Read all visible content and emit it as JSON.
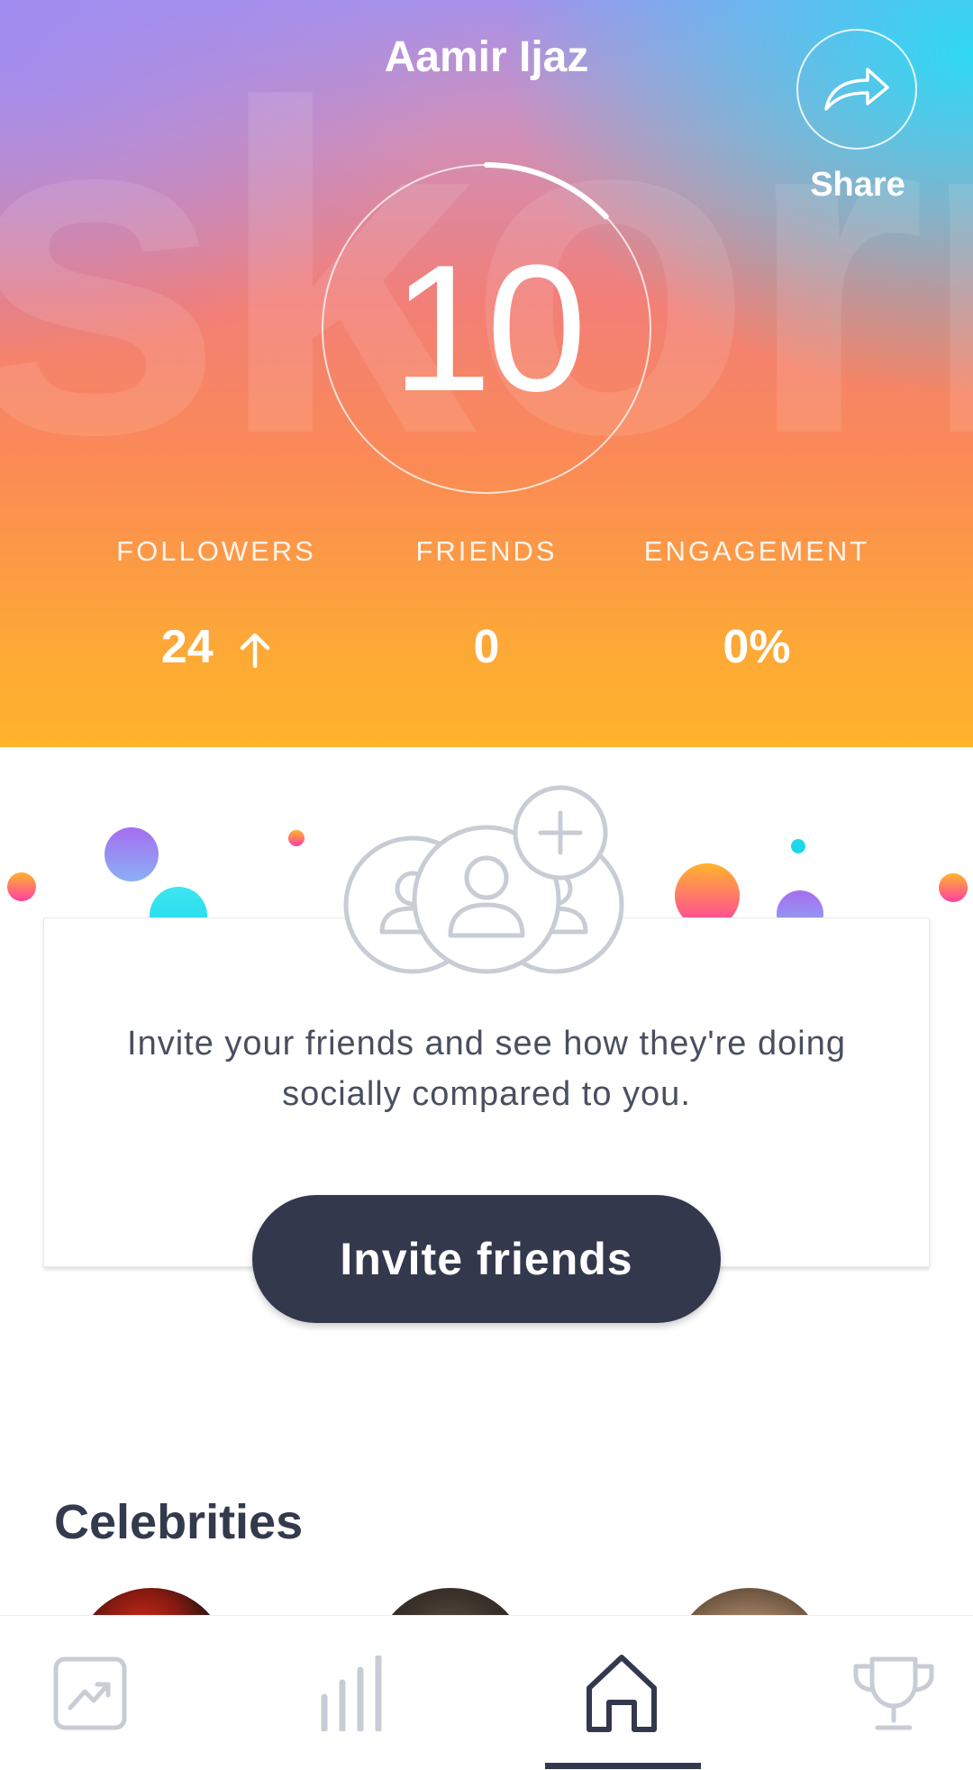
{
  "header": {
    "watermark": "skorr",
    "user_name": "Aamir Ijaz",
    "share_label": "Share",
    "share_icon": "share-arrow-icon",
    "score": "10",
    "score_progress": 0.13
  },
  "stats": [
    {
      "label": "FOLLOWERS",
      "value": "24",
      "trend_icon": "arrow-up-icon"
    },
    {
      "label": "FRIENDS",
      "value": "0"
    },
    {
      "label": "ENGAGEMENT",
      "value": "0%"
    }
  ],
  "invite": {
    "icon": "add-friends-icon",
    "message": "Invite your friends and see how they're doing socially compared to you.",
    "button_label": "Invite friends"
  },
  "celebrities": {
    "title": "Celebrities"
  },
  "bottom_nav": {
    "items": [
      {
        "icon": "trend-chart-icon",
        "active": false
      },
      {
        "icon": "bar-chart-icon",
        "active": false
      },
      {
        "icon": "home-icon",
        "active": true
      },
      {
        "icon": "trophy-icon",
        "active": false
      }
    ]
  },
  "colors": {
    "dark": "#33384d",
    "gradient_top_left": "#a792ea",
    "gradient_top_right": "#28dcf5",
    "gradient_middle": "#f27f78",
    "gradient_bottom": "#ffb42c",
    "icon_gray": "#c8ccd4"
  }
}
